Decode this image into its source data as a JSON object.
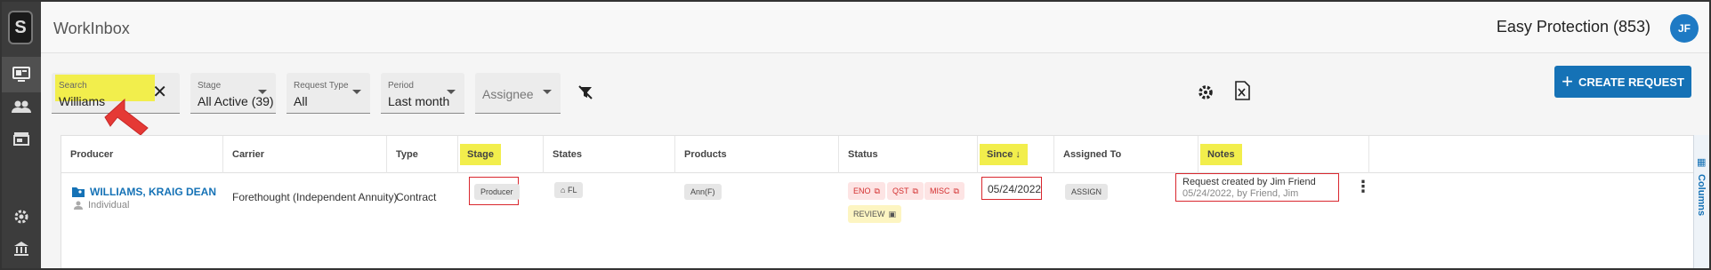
{
  "app": {
    "title": "WorkInbox",
    "org": "Easy Protection (853)",
    "user_initials": "JF",
    "logo": "S"
  },
  "rail": {
    "icons": [
      "monitor-icon",
      "people-icon",
      "store-icon",
      "gear-icon",
      "bank-icon"
    ],
    "active": "monitor-icon"
  },
  "filters": {
    "search": {
      "label": "Search",
      "value": "Williams"
    },
    "stage": {
      "label": "Stage",
      "value": "All Active (39)"
    },
    "request_type": {
      "label": "Request Type",
      "value": "All"
    },
    "period": {
      "label": "Period",
      "value": "Last month"
    },
    "assignee": {
      "placeholder": "Assignee"
    }
  },
  "actions": {
    "create_label": "CREATE REQUEST"
  },
  "table": {
    "columns": [
      "Producer",
      "Carrier",
      "Type",
      "Stage",
      "States",
      "Products",
      "Status",
      "Since",
      "Assigned To",
      "Notes"
    ],
    "rows": [
      {
        "producer_name": "WILLIAMS, KRAIG DEAN",
        "producer_sub": "Individual",
        "carrier": "Forethought (Independent Annuity)",
        "type": "Contract",
        "stage": "Producer",
        "state": "FL",
        "product": "Ann(F)",
        "status": [
          "ENO",
          "QST",
          "MISC",
          "REVIEW"
        ],
        "since": "05/24/2022",
        "assigned": "ASSIGN",
        "note_title": "Request created by Jim Friend",
        "note_sub": "05/24/2022, by Friend, Jim"
      }
    ],
    "columns_toggle": "Columns"
  },
  "colors": {
    "accent": "#1572b6",
    "highlight": "#f2ee4c",
    "annotation": "#d9272e"
  }
}
